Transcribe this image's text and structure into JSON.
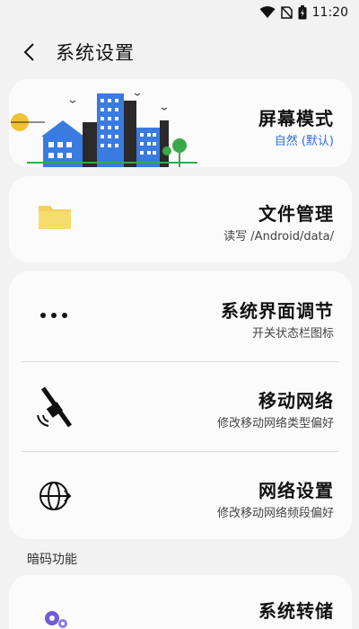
{
  "status_bar": {
    "time": "11:20"
  },
  "header": {
    "title": "系统设置"
  },
  "cards": {
    "screen_mode": {
      "title": "屏幕模式",
      "subtitle": "自然 (默认)"
    },
    "file_manage": {
      "title": "文件管理",
      "subtitle": "读写 /Android/data/"
    },
    "ui_tuning": {
      "title": "系统界面调节",
      "subtitle": "开关状态栏图标"
    },
    "mobile_net": {
      "title": "移动网络",
      "subtitle": "修改移动网络类型偏好"
    },
    "net_settings": {
      "title": "网络设置",
      "subtitle": "修改移动网络频段偏好"
    },
    "system_dump": {
      "title": "系统转储"
    }
  },
  "section": {
    "label": "暗码功能"
  },
  "colors": {
    "accent": "#2f6fd6",
    "folder": "#f2d35a",
    "building_blue": "#3a7be0"
  }
}
